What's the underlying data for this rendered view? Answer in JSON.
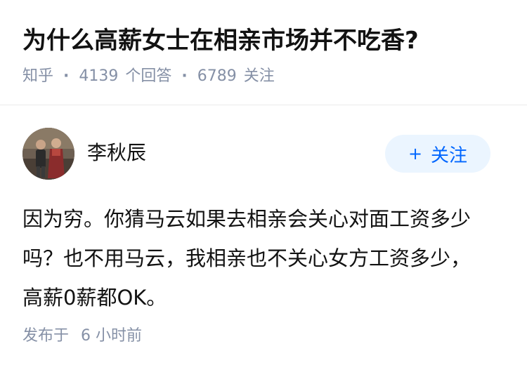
{
  "question": {
    "title": "为什么高薪女士在相亲市场并不吃香?",
    "source": "知乎",
    "answer_count": "4139",
    "answer_label": "个回答",
    "follower_count": "6789",
    "follower_label": "关注"
  },
  "answer": {
    "author_name": "李秋辰",
    "follow_label": "关注",
    "follow_icon": "plus-icon",
    "lines": [
      "因为穷。你猜马云如果去相亲会关心对面工资多少",
      "吗？也不用马云，我相亲也不关心女方工资多少，",
      "高薪0薪都OK。"
    ],
    "publish_label": "发布于",
    "publish_time": "6 小时前"
  },
  "colors": {
    "meta_gray": "#8590a6",
    "brand_blue": "#0066ff",
    "follow_bg": "#ebf5ff",
    "text": "#121212"
  }
}
